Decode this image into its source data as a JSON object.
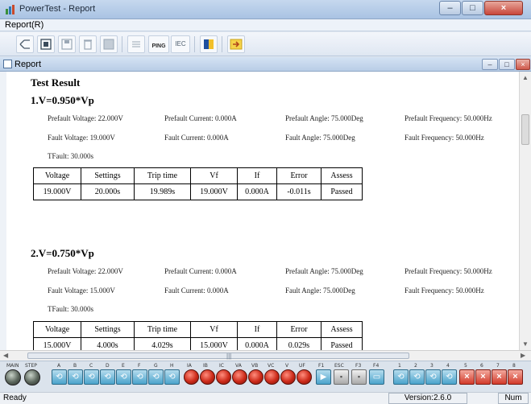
{
  "window": {
    "title": "PowerTest - Report",
    "minimize": "–",
    "maximize": "□",
    "close": "×"
  },
  "menu": {
    "report": "Report(R)"
  },
  "toolbar": {
    "ping": "PING",
    "iec": "IEC"
  },
  "report_window": {
    "title": "Report"
  },
  "report": {
    "heading": "Test Result",
    "table_headers": [
      "Voltage",
      "Settings",
      "Trip time",
      "Vf",
      "If",
      "Error",
      "Assess"
    ],
    "sections": [
      {
        "title": "1.V=0.950*Vp",
        "prefault_voltage": "Prefault Voltage: 22.000V",
        "prefault_current": "Prefault Current: 0.000A",
        "prefault_angle": "Prefault Angle: 75.000Deg",
        "prefault_frequency": "Prefault Frequency: 50.000Hz",
        "fault_voltage": "Fault Voltage: 19.000V",
        "fault_current": "Fault Current: 0.000A",
        "fault_angle": "Fault Angle: 75.000Deg",
        "fault_frequency": "Fault Frequency: 50.000Hz",
        "tfault": "TFault: 30.000s",
        "row": [
          "19.000V",
          "20.000s",
          "19.989s",
          "19.000V",
          "0.000A",
          "-0.011s",
          "Passed"
        ]
      },
      {
        "title": "2.V=0.750*Vp",
        "prefault_voltage": "Prefault Voltage: 22.000V",
        "prefault_current": "Prefault Current: 0.000A",
        "prefault_angle": "Prefault Angle: 75.000Deg",
        "prefault_frequency": "Prefault Frequency: 50.000Hz",
        "fault_voltage": "Fault Voltage: 15.000V",
        "fault_current": "Fault Current: 0.000A",
        "fault_angle": "Fault Angle: 75.000Deg",
        "fault_frequency": "Fault Frequency: 50.000Hz",
        "tfault": "TFault: 30.000s",
        "row": [
          "15.000V",
          "4.000s",
          "4.029s",
          "15.000V",
          "0.000A",
          "0.029s",
          "Passed"
        ]
      }
    ]
  },
  "strip": {
    "knob_labels": [
      "MAIN",
      "STEP"
    ],
    "blue_labels": [
      "A",
      "B",
      "C",
      "D",
      "E",
      "F",
      "G",
      "H"
    ],
    "red_labels": [
      "IA",
      "IB",
      "IC",
      "VA",
      "VB",
      "VC",
      "V",
      "UF"
    ],
    "function_labels": [
      "F1",
      "ESC",
      "F3",
      "F4"
    ],
    "number_labels": [
      "1",
      "2",
      "3",
      "4",
      "5",
      "6",
      "7",
      "8"
    ]
  },
  "status": {
    "ready": "Ready",
    "version": "Version:2.6.0",
    "num": "Num"
  },
  "colors": {
    "accent": "#4aa3cc",
    "alert": "#cc2a19"
  }
}
